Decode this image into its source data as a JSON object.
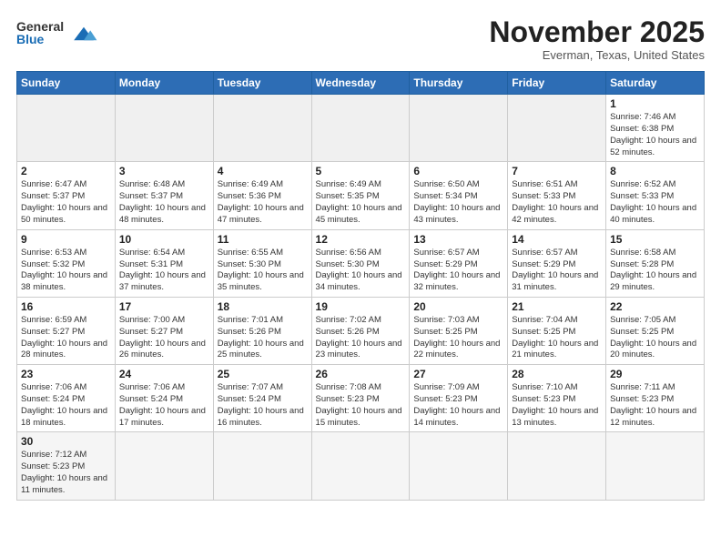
{
  "logo": {
    "general": "General",
    "blue": "Blue"
  },
  "header": {
    "month": "November 2025",
    "location": "Everman, Texas, United States"
  },
  "weekdays": [
    "Sunday",
    "Monday",
    "Tuesday",
    "Wednesday",
    "Thursday",
    "Friday",
    "Saturday"
  ],
  "weeks": [
    [
      {
        "day": "",
        "empty": true
      },
      {
        "day": "",
        "empty": true
      },
      {
        "day": "",
        "empty": true
      },
      {
        "day": "",
        "empty": true
      },
      {
        "day": "",
        "empty": true
      },
      {
        "day": "",
        "empty": true
      },
      {
        "day": "1",
        "info": "Sunrise: 7:46 AM\nSunset: 6:38 PM\nDaylight: 10 hours and 52 minutes."
      }
    ],
    [
      {
        "day": "2",
        "info": "Sunrise: 6:47 AM\nSunset: 5:37 PM\nDaylight: 10 hours and 50 minutes."
      },
      {
        "day": "3",
        "info": "Sunrise: 6:48 AM\nSunset: 5:37 PM\nDaylight: 10 hours and 48 minutes."
      },
      {
        "day": "4",
        "info": "Sunrise: 6:49 AM\nSunset: 5:36 PM\nDaylight: 10 hours and 47 minutes."
      },
      {
        "day": "5",
        "info": "Sunrise: 6:49 AM\nSunset: 5:35 PM\nDaylight: 10 hours and 45 minutes."
      },
      {
        "day": "6",
        "info": "Sunrise: 6:50 AM\nSunset: 5:34 PM\nDaylight: 10 hours and 43 minutes."
      },
      {
        "day": "7",
        "info": "Sunrise: 6:51 AM\nSunset: 5:33 PM\nDaylight: 10 hours and 42 minutes."
      },
      {
        "day": "8",
        "info": "Sunrise: 6:52 AM\nSunset: 5:33 PM\nDaylight: 10 hours and 40 minutes."
      }
    ],
    [
      {
        "day": "9",
        "info": "Sunrise: 6:53 AM\nSunset: 5:32 PM\nDaylight: 10 hours and 38 minutes."
      },
      {
        "day": "10",
        "info": "Sunrise: 6:54 AM\nSunset: 5:31 PM\nDaylight: 10 hours and 37 minutes."
      },
      {
        "day": "11",
        "info": "Sunrise: 6:55 AM\nSunset: 5:30 PM\nDaylight: 10 hours and 35 minutes."
      },
      {
        "day": "12",
        "info": "Sunrise: 6:56 AM\nSunset: 5:30 PM\nDaylight: 10 hours and 34 minutes."
      },
      {
        "day": "13",
        "info": "Sunrise: 6:57 AM\nSunset: 5:29 PM\nDaylight: 10 hours and 32 minutes."
      },
      {
        "day": "14",
        "info": "Sunrise: 6:57 AM\nSunset: 5:29 PM\nDaylight: 10 hours and 31 minutes."
      },
      {
        "day": "15",
        "info": "Sunrise: 6:58 AM\nSunset: 5:28 PM\nDaylight: 10 hours and 29 minutes."
      }
    ],
    [
      {
        "day": "16",
        "info": "Sunrise: 6:59 AM\nSunset: 5:27 PM\nDaylight: 10 hours and 28 minutes."
      },
      {
        "day": "17",
        "info": "Sunrise: 7:00 AM\nSunset: 5:27 PM\nDaylight: 10 hours and 26 minutes."
      },
      {
        "day": "18",
        "info": "Sunrise: 7:01 AM\nSunset: 5:26 PM\nDaylight: 10 hours and 25 minutes."
      },
      {
        "day": "19",
        "info": "Sunrise: 7:02 AM\nSunset: 5:26 PM\nDaylight: 10 hours and 23 minutes."
      },
      {
        "day": "20",
        "info": "Sunrise: 7:03 AM\nSunset: 5:25 PM\nDaylight: 10 hours and 22 minutes."
      },
      {
        "day": "21",
        "info": "Sunrise: 7:04 AM\nSunset: 5:25 PM\nDaylight: 10 hours and 21 minutes."
      },
      {
        "day": "22",
        "info": "Sunrise: 7:05 AM\nSunset: 5:25 PM\nDaylight: 10 hours and 20 minutes."
      }
    ],
    [
      {
        "day": "23",
        "info": "Sunrise: 7:06 AM\nSunset: 5:24 PM\nDaylight: 10 hours and 18 minutes."
      },
      {
        "day": "24",
        "info": "Sunrise: 7:06 AM\nSunset: 5:24 PM\nDaylight: 10 hours and 17 minutes."
      },
      {
        "day": "25",
        "info": "Sunrise: 7:07 AM\nSunset: 5:24 PM\nDaylight: 10 hours and 16 minutes."
      },
      {
        "day": "26",
        "info": "Sunrise: 7:08 AM\nSunset: 5:23 PM\nDaylight: 10 hours and 15 minutes."
      },
      {
        "day": "27",
        "info": "Sunrise: 7:09 AM\nSunset: 5:23 PM\nDaylight: 10 hours and 14 minutes."
      },
      {
        "day": "28",
        "info": "Sunrise: 7:10 AM\nSunset: 5:23 PM\nDaylight: 10 hours and 13 minutes."
      },
      {
        "day": "29",
        "info": "Sunrise: 7:11 AM\nSunset: 5:23 PM\nDaylight: 10 hours and 12 minutes."
      }
    ],
    [
      {
        "day": "30",
        "info": "Sunrise: 7:12 AM\nSunset: 5:23 PM\nDaylight: 10 hours and 11 minutes."
      },
      {
        "day": "",
        "empty": true
      },
      {
        "day": "",
        "empty": true
      },
      {
        "day": "",
        "empty": true
      },
      {
        "day": "",
        "empty": true
      },
      {
        "day": "",
        "empty": true
      },
      {
        "day": "",
        "empty": true
      }
    ]
  ]
}
